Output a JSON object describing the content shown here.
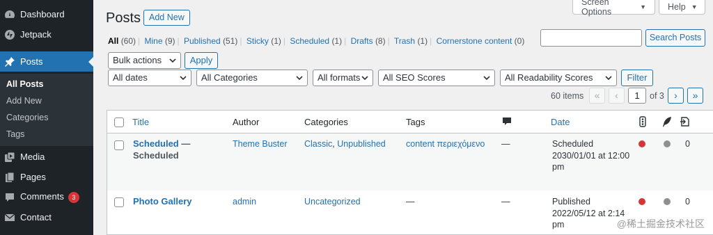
{
  "sidebar": {
    "items": [
      {
        "label": "Dashboard",
        "icon": "dashboard-icon"
      },
      {
        "label": "Jetpack",
        "icon": "jetpack-icon"
      },
      {
        "label": "Posts",
        "icon": "pin-icon"
      },
      {
        "label": "Media",
        "icon": "media-icon"
      },
      {
        "label": "Pages",
        "icon": "pages-icon"
      },
      {
        "label": "Comments",
        "icon": "comments-icon",
        "badge": "3"
      },
      {
        "label": "Contact",
        "icon": "mail-icon"
      }
    ],
    "submenu": [
      "All Posts",
      "Add New",
      "Categories",
      "Tags"
    ]
  },
  "screen_options": {
    "label": "Screen Options"
  },
  "help": {
    "label": "Help"
  },
  "header": {
    "title": "Posts",
    "add_new": "Add New"
  },
  "filters": [
    {
      "label": "All",
      "count": "(60)"
    },
    {
      "label": "Mine",
      "count": "(9)"
    },
    {
      "label": "Published",
      "count": "(51)"
    },
    {
      "label": "Sticky",
      "count": "(1)"
    },
    {
      "label": "Scheduled",
      "count": "(1)"
    },
    {
      "label": "Drafts",
      "count": "(8)"
    },
    {
      "label": "Trash",
      "count": "(1)"
    },
    {
      "label": "Cornerstone content",
      "count": "(0)"
    }
  ],
  "search": {
    "button": "Search Posts",
    "value": ""
  },
  "bulk": {
    "select": "Bulk actions",
    "apply": "Apply"
  },
  "filter_selects": {
    "dates": "All dates",
    "categories": "All Categories",
    "formats": "All formats",
    "seo": "All SEO Scores",
    "readability": "All Readability Scores",
    "filter_button": "Filter"
  },
  "pagination": {
    "items": "60 items",
    "first": "«",
    "prev": "‹",
    "current": "1",
    "of": "of 3",
    "next": "›",
    "last": "»"
  },
  "table": {
    "headers": {
      "title": "Title",
      "author": "Author",
      "categories": "Categories",
      "tags": "Tags",
      "date": "Date"
    },
    "rows": [
      {
        "title": "Scheduled",
        "state": "— Scheduled",
        "author": "Theme Buster",
        "cat1": "Classic",
        "cat_sep": ",",
        "cat2": "Unpublished",
        "tags": "content περιεχόμενο",
        "comments": "—",
        "date_status": "Scheduled",
        "date_line2": "2030/01/01 at 12:00",
        "date_line3": "pm",
        "links": "0"
      },
      {
        "title": "Photo Gallery",
        "author": "admin",
        "cat1": "Uncategorized",
        "tags": "—",
        "comments": "—",
        "date_status": "Published",
        "date_line2": "2022/05/12 at 2:14",
        "date_line3": "pm",
        "links": "0"
      }
    ]
  },
  "watermark": "@稀土掘金技术社区",
  "colors": {
    "sidebar": "#1d2327",
    "accent": "#2271b1",
    "seo_bad": "#d63638",
    "readability_na": "#8c8f94"
  }
}
